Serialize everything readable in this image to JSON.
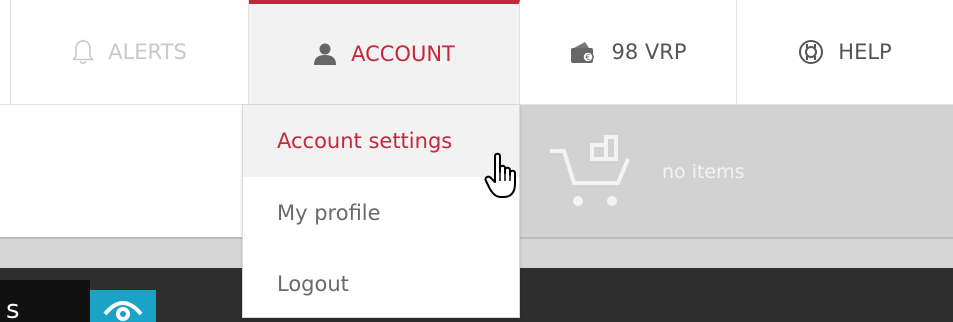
{
  "nav": {
    "alerts_label": "ALERTS",
    "account_label": "ACCOUNT",
    "vrp_label": "98 VRP",
    "help_label": "HELP"
  },
  "account_menu": {
    "items": [
      {
        "label": "Account settings",
        "active": true
      },
      {
        "label": "My profile",
        "active": false
      },
      {
        "label": "Logout",
        "active": false
      }
    ]
  },
  "cart": {
    "status": "no items"
  },
  "bottom": {
    "tab_text": "s"
  },
  "icons": {
    "alerts": "bell-icon",
    "account": "user-icon",
    "vrp": "wallet-icon",
    "help": "lifebuoy-icon",
    "cart": "cart-icon",
    "eye": "eye-icon",
    "cursor": "hand-pointer-icon"
  },
  "colors": {
    "accent": "#c4283a",
    "muted": "#c9c9c9",
    "cart_bg": "#d2d2d2",
    "eye_button": "#1ba3c7"
  }
}
